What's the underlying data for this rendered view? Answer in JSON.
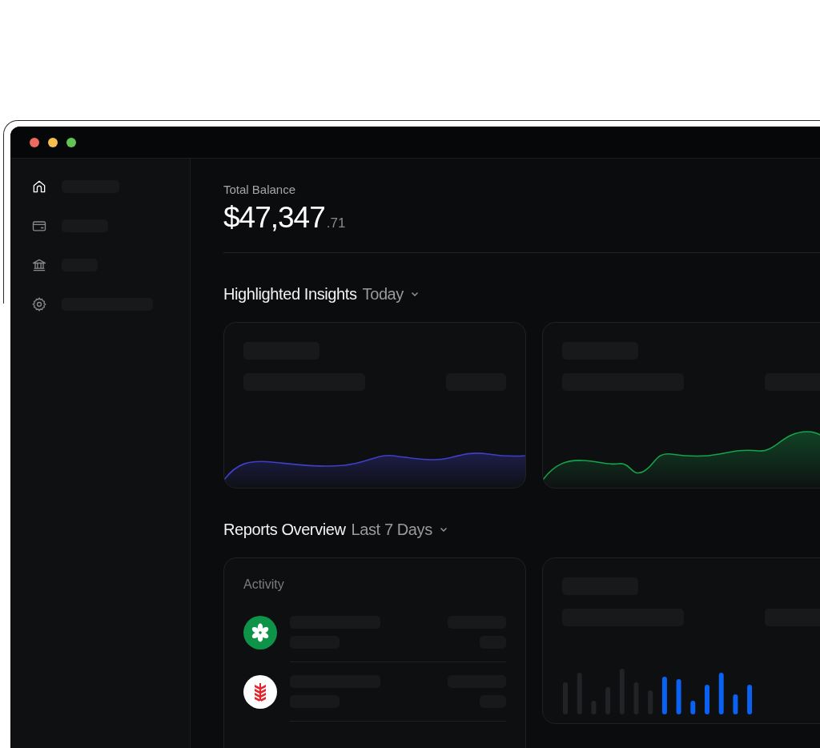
{
  "sidebar": {
    "items": [
      {
        "kind": "home",
        "selected": true
      },
      {
        "kind": "card",
        "selected": false
      },
      {
        "kind": "bank",
        "selected": false
      },
      {
        "kind": "settings",
        "selected": false
      }
    ]
  },
  "balance": {
    "label": "Total Balance",
    "whole": "$47,347",
    "cents": ".71"
  },
  "insights": {
    "title": "Highlighted Insights",
    "period": "Today",
    "cards": [
      {
        "color": "#3f3fc8"
      },
      {
        "color": "#16a34a"
      }
    ]
  },
  "reports": {
    "title": "Reports Overview",
    "period": "Last 7 Days",
    "activity": {
      "title": "Activity",
      "items": [
        {
          "kind": "clover"
        },
        {
          "kind": "wheat"
        }
      ]
    }
  }
}
